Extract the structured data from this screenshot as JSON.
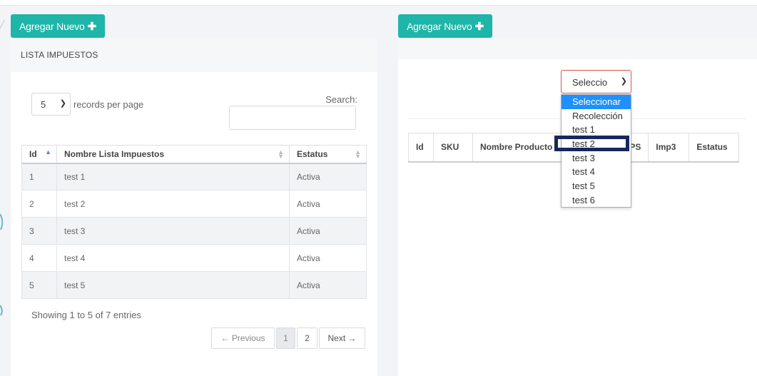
{
  "left_panel": {
    "add_button": "Agregar Nuevo",
    "title": "LISTA IMPUESTOS",
    "page_length": "5",
    "page_length_label": "records per page",
    "search_label": "Search:",
    "search_value": "",
    "columns": [
      "Id",
      "Nombre Lista Impuestos",
      "Estatus"
    ],
    "rows": [
      [
        "1",
        "test 1",
        "Activa"
      ],
      [
        "2",
        "test 2",
        "Activa"
      ],
      [
        "3",
        "test 3",
        "Activa"
      ],
      [
        "4",
        "test 4",
        "Activa"
      ],
      [
        "5",
        "test 5",
        "Activa"
      ]
    ],
    "info": "Showing 1 to 5 of 7 entries",
    "pagination": {
      "previous": "← Previous",
      "pages": [
        "1",
        "2"
      ],
      "current": "1",
      "next": "Next →"
    }
  },
  "right_panel": {
    "add_button": "Agregar Nuevo",
    "select_value": "Seleccio",
    "dropdown_options": [
      "Seleccionar",
      "Recolección",
      "test 1",
      "test 2",
      "test 3",
      "test 4",
      "test 5",
      "test 6"
    ],
    "selected_option_index": 0,
    "highlighted_option": "test 2",
    "columns": [
      "Id",
      "SKU",
      "Nombre Producto",
      "IEPS",
      "Imp3",
      "Estatus"
    ]
  },
  "colors": {
    "accent": "#1fb5a8",
    "dropdown_selected": "#1e90ff",
    "highlight_box": "#15295c",
    "select_border": "#d9534f"
  }
}
